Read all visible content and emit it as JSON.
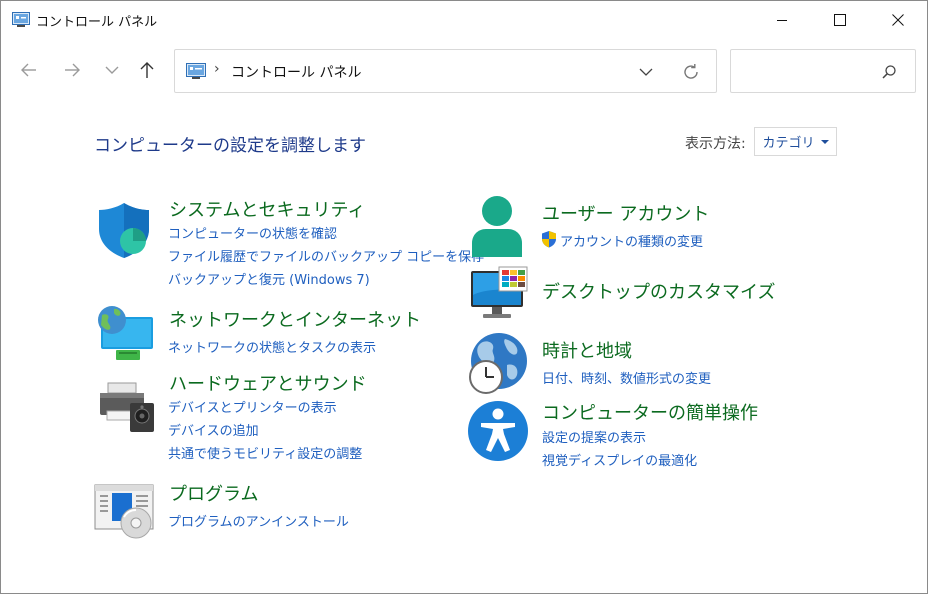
{
  "window": {
    "title": "コントロール パネル"
  },
  "navigation": {
    "address_separator": "›",
    "address_text": "コントロール パネル",
    "search_placeholder": ""
  },
  "header": {
    "title": "コンピューターの設定を調整します",
    "view_by_label": "表示方法:",
    "view_by_value": "カテゴリ"
  },
  "categories": [
    {
      "title": "システムとセキュリティ",
      "icon": "security-shield-icon",
      "links": [
        "コンピューターの状態を確認",
        "ファイル履歴でファイルのバックアップ コピーを保存",
        "バックアップと復元 (Windows 7)"
      ]
    },
    {
      "title": "ネットワークとインターネット",
      "icon": "network-globe-icon",
      "links": [
        "ネットワークの状態とタスクの表示"
      ]
    },
    {
      "title": "ハードウェアとサウンド",
      "icon": "printer-speaker-icon",
      "links": [
        "デバイスとプリンターの表示",
        "デバイスの追加",
        "共通で使うモビリティ設定の調整"
      ]
    },
    {
      "title": "プログラム",
      "icon": "programs-disc-icon",
      "links": [
        "プログラムのアンインストール"
      ]
    },
    {
      "title": "ユーザー アカウント",
      "icon": "user-accounts-icon",
      "links": [
        "アカウントの種類の変更"
      ]
    },
    {
      "title": "デスクトップのカスタマイズ",
      "icon": "desktop-monitor-icon",
      "links": []
    },
    {
      "title": "時計と地域",
      "icon": "clock-globe-icon",
      "links": [
        "日付、時刻、数値形式の変更"
      ]
    },
    {
      "title": "コンピューターの簡単操作",
      "icon": "accessibility-icon",
      "links": [
        "設定の提案の表示",
        "視覚ディスプレイの最適化"
      ]
    }
  ],
  "colors": {
    "title_green": "#0b6a1f",
    "link_blue": "#1f5fbf",
    "heading_navy": "#1e3a8a"
  }
}
